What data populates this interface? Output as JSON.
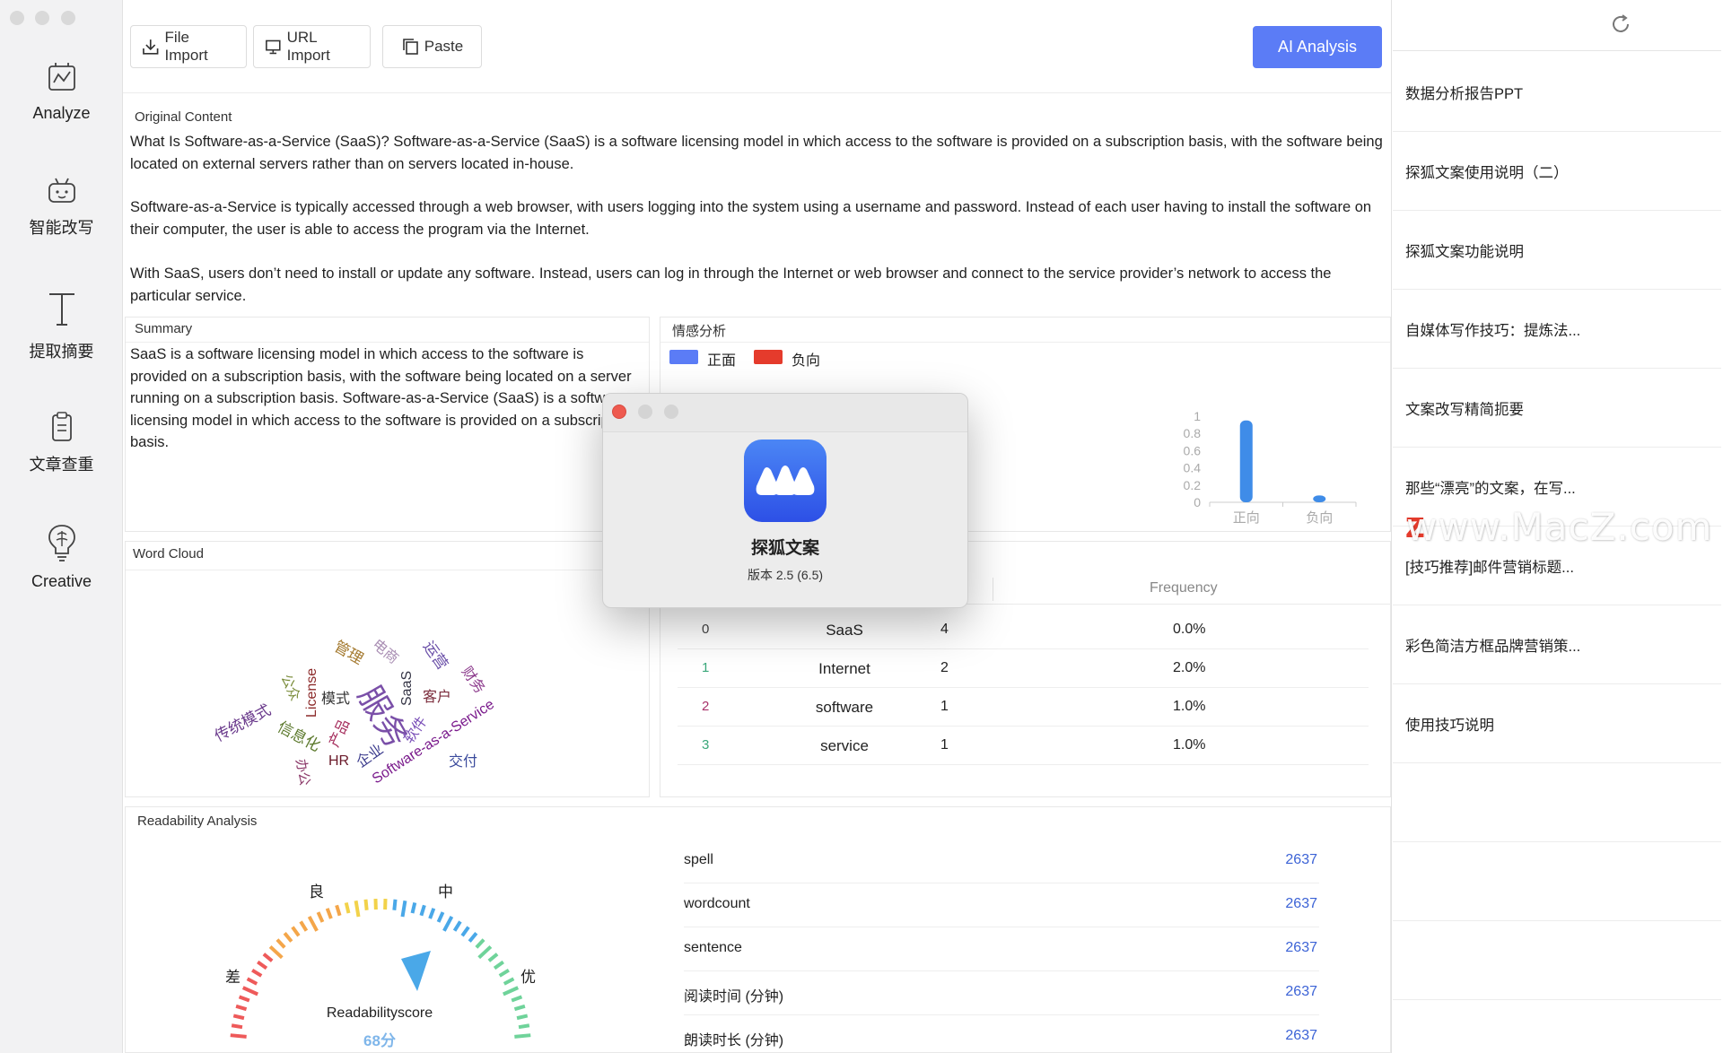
{
  "toolbar": {
    "file_import": "File Import",
    "url_import": "URL Import",
    "paste": "Paste",
    "ai_analysis": "AI Analysis"
  },
  "sidebar": {
    "items": [
      {
        "label": "Analyze",
        "icon": "analyze-icon"
      },
      {
        "label": "智能改写",
        "icon": "robot-icon"
      },
      {
        "label": "提取摘要",
        "icon": "text-icon"
      },
      {
        "label": "文章查重",
        "icon": "clipboard-icon"
      },
      {
        "label": "Creative",
        "icon": "brain-bulb-icon"
      }
    ]
  },
  "original": {
    "title": "Original Content",
    "p1": "What Is Software-as-a-Service (SaaS)? Software-as-a-Service (SaaS) is a software licensing model in which access to the software is provided on a subscription basis, with the software being located on external servers rather than on servers located in-house.",
    "p2": "Software-as-a-Service is typically accessed through a web browser, with users logging into the system using a username and password. Instead of each user having to install the software on their computer, the user is able to access the program via the Internet.",
    "p3": "With SaaS, users don’t need to install or update any software. Instead, users can log in through the Internet or web browser and connect to the service provider’s network to access the particular service."
  },
  "summary": {
    "title": "Summary",
    "text": "SaaS is a software licensing model in which access to the software is provided on a subscription basis, with the software being located on a server running on a subscription basis. Software-as-a-Service (SaaS) is a software licensing model in which access to the software is provided on a subscription basis."
  },
  "sentiment": {
    "title": "情感分析",
    "legend_positive": "正面",
    "legend_negative": "负向",
    "positive_color": "#5b7cf6",
    "negative_color": "#e53b2c",
    "bar_color": "#3f8ce8"
  },
  "chart_data": {
    "type": "bar",
    "categories": [
      "正向",
      "负向"
    ],
    "values": [
      0.95,
      0.08
    ],
    "yticks": [
      "1",
      "0.8",
      "0.6",
      "0.4",
      "0.2",
      "0"
    ],
    "ylim": [
      0,
      1
    ]
  },
  "wordcloud": {
    "title": "Word Cloud",
    "words": [
      "传统模式",
      "信息化",
      "办公",
      "管理",
      "模式",
      "服务",
      "电商",
      "License",
      "SaaS",
      "运营",
      "客户",
      "财务",
      "软件",
      "产品",
      "HR",
      "企业",
      "交付",
      "Software-as-a-Service",
      "公众"
    ]
  },
  "frequency": {
    "header": "Frequency",
    "rows": [
      {
        "idx": "0",
        "word": "SaaS",
        "count": "4",
        "pct": "0.0%"
      },
      {
        "idx": "1",
        "word": "Internet",
        "count": "2",
        "pct": "2.0%"
      },
      {
        "idx": "2",
        "word": "software",
        "count": "1",
        "pct": "1.0%"
      },
      {
        "idx": "3",
        "word": "service",
        "count": "1",
        "pct": "1.0%"
      }
    ]
  },
  "readability": {
    "title": "Readability Analysis",
    "gauge_labels": {
      "poor": "差",
      "good": "良",
      "medium": "中",
      "excellent": "优"
    },
    "score_label": "Readabilityscore",
    "score": "68分",
    "rows": [
      {
        "key": "spell",
        "value": "2637"
      },
      {
        "key": "wordcount",
        "value": "2637"
      },
      {
        "key": "sentence",
        "value": "2637"
      },
      {
        "key": "阅读时间 (分钟)",
        "value": "2637"
      },
      {
        "key": "朗读时长 (分钟)",
        "value": "2637"
      }
    ]
  },
  "history": {
    "items": [
      "数据分析报告PPT",
      "探狐文案使用说明（二）",
      "探狐文案功能说明",
      "自媒体写作技巧：提炼法...",
      "文案改写精简扼要",
      "那些“漂亮”的文案，在写...",
      "[技巧推荐]邮件营销标题...",
      "彩色简洁方框品牌营销策...",
      "使用技巧说明"
    ]
  },
  "dialog": {
    "app_name": "探狐文案",
    "version": "版本 2.5 (6.5)"
  },
  "watermark": {
    "text": "www.MacZ.com",
    "z": "Z"
  }
}
